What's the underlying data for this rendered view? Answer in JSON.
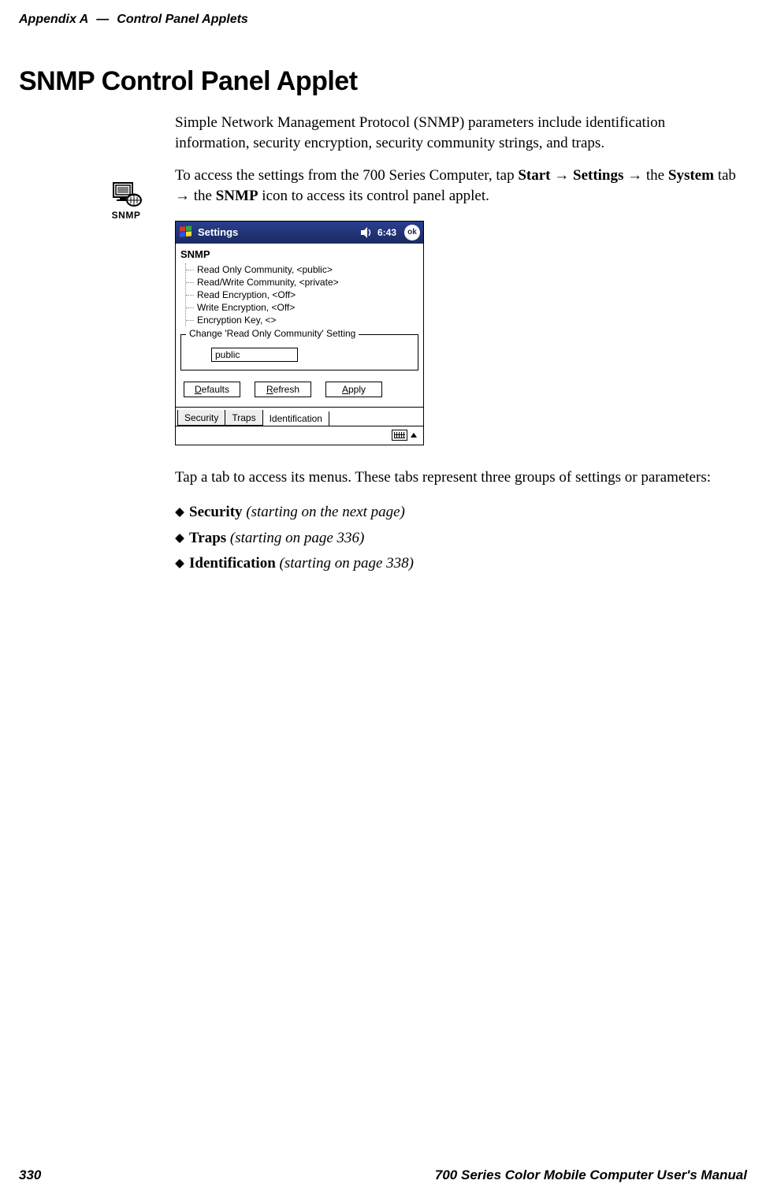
{
  "header": {
    "appendix": "Appendix  A",
    "dash": "—",
    "chapter": "Control Panel Applets"
  },
  "title": "SNMP Control Panel Applet",
  "intro": "Simple Network Management Protocol (SNMP) parameters include identification information, security encryption, security community strings, and traps.",
  "access": {
    "pre": "To access the settings from the 700 Series Computer, tap ",
    "b1": "Start",
    "b2": "Settings",
    "mid1": " the ",
    "b3": "System",
    "mid2": " tab ",
    "mid3": " the ",
    "b4": "SNMP",
    "post": " icon to access its control panel applet."
  },
  "icon_label": "SNMP",
  "ppc": {
    "titlebar": "Settings",
    "time": "6:43",
    "ok": "ok",
    "app_title": "SNMP",
    "tree": [
      "Read Only Community, <public>",
      "Read/Write Community, <private>",
      "Read Encryption, <Off>",
      "Write Encryption, <Off>",
      "Encryption Key, <>"
    ],
    "fieldset_legend": "Change 'Read Only Community' Setting",
    "fieldset_value": "public",
    "buttons": {
      "defaults": "Defaults",
      "refresh": "Refresh",
      "apply": "Apply"
    },
    "tabs": [
      "Security",
      "Traps",
      "Identification"
    ]
  },
  "post_para": "Tap a tab to access its menus. These tabs represent three groups of settings or parameters:",
  "list": [
    {
      "bold": "Security",
      "ital": " (starting on the next page)"
    },
    {
      "bold": "Traps",
      "ital": " (starting on page 336)"
    },
    {
      "bold": "Identification",
      "ital": " (starting on page 338)"
    }
  ],
  "footer": {
    "page": "330",
    "manual": "700 Series Color Mobile Computer User's Manual"
  }
}
